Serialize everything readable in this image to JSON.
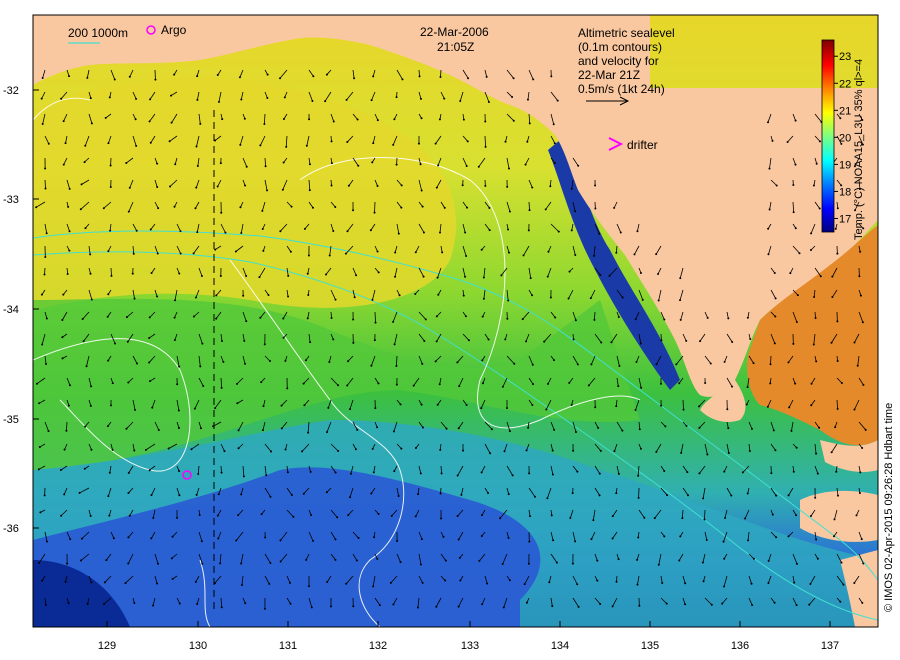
{
  "map": {
    "header": {
      "date": "22-Mar-2006",
      "time": "21:05Z"
    },
    "bathy_legend": {
      "label": "200  1000m",
      "line_color": "#40e0d0"
    },
    "argo": {
      "label": "Argo",
      "color": "#ff00ff",
      "lon": 129.9,
      "lat": -35.5
    },
    "drifter": {
      "label": "drifter",
      "color": "#ff00ff"
    },
    "altimetry_note": {
      "line1": "Altimetric sealevel",
      "line2": "(0.1m contours)",
      "line3": "and velocity for",
      "line4": "22-Mar 21Z",
      "line5": "0.5m/s (1kt 24h)"
    },
    "colorbar": {
      "title": "Temp. (°C) NOAA15_L3U 35% ql>=4",
      "min": 16.5,
      "max": 23.6,
      "ticks": [
        "17",
        "18",
        "19",
        "20",
        "21",
        "22",
        "23"
      ],
      "colors": [
        "#00007f",
        "#0000ff",
        "#007fff",
        "#00ffff",
        "#7fff7f",
        "#ffff00",
        "#ff7f00",
        "#ff0000",
        "#7f0000"
      ]
    },
    "credit": "© IMOS 02-Apr-2015 09:26:28 Hdbart time",
    "lon_ticks": [
      "129",
      "130",
      "131",
      "132",
      "133",
      "134",
      "135",
      "136",
      "137"
    ],
    "lat_ticks": [
      "-32",
      "-33",
      "-34",
      "-35",
      "-36"
    ],
    "land_color": "#fac8a0",
    "ocean_colors": {
      "warm": "#e6dc28",
      "mid": "#a0e628",
      "green": "#3cc83c",
      "cool": "#28b4c8",
      "cold": "#2850dc",
      "deep": "#0a28a0",
      "gulf": "#e68c28"
    }
  }
}
